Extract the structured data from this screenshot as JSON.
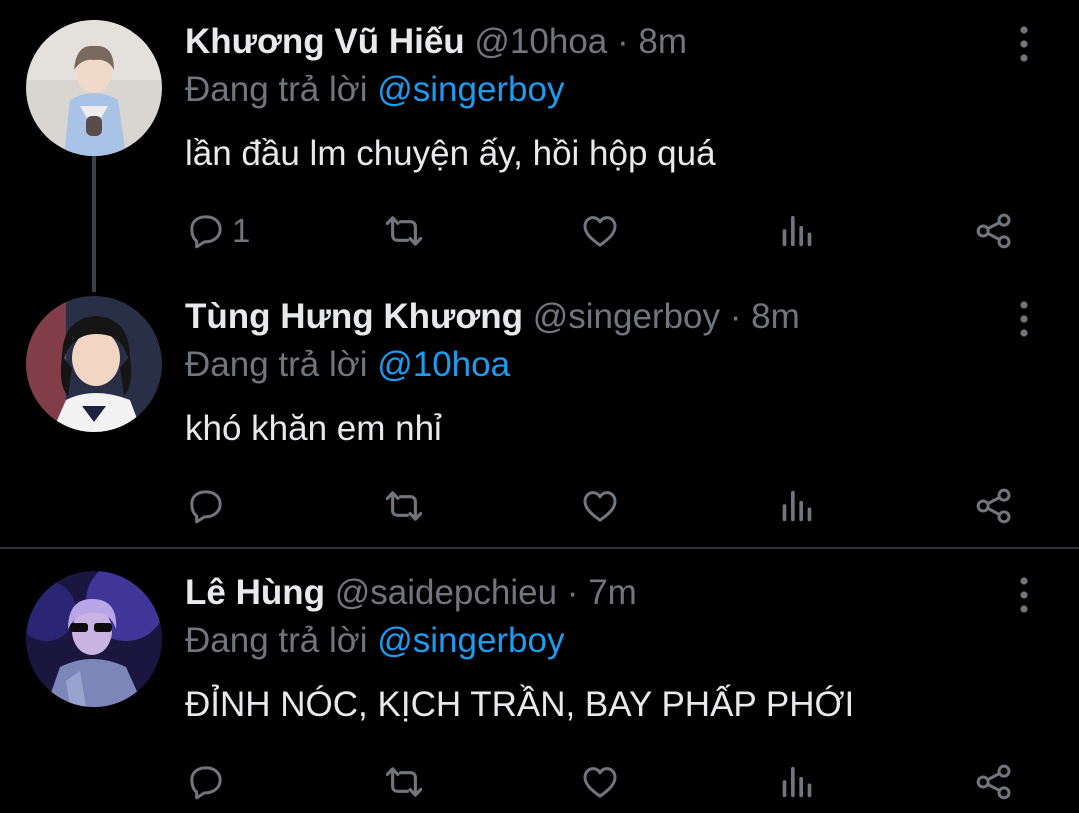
{
  "colors": {
    "background": "#000000",
    "text": "#e7e9ea",
    "muted": "#71767b",
    "mention": "#1d9bf0",
    "divider": "#2f3336"
  },
  "tweets": [
    {
      "name": "Khương Vũ Hiếu",
      "handle": "@10hoa",
      "separator": "·",
      "time": "8m",
      "reply_prefix": "Đang trả lời",
      "reply_to": "@singerboy",
      "text": "lần đầu lm chuyện ấy, hồi hộp quá",
      "reply_count": "1",
      "icons": [
        "reply-icon",
        "retweet-icon",
        "like-icon",
        "analytics-icon",
        "share-icon",
        "more-icon"
      ]
    },
    {
      "name": "Tùng Hưng Khương",
      "handle": "@singerboy",
      "separator": "·",
      "time": "8m",
      "reply_prefix": "Đang trả lời",
      "reply_to": "@10hoa",
      "text": "khó khăn em nhỉ",
      "reply_count": "",
      "icons": [
        "reply-icon",
        "retweet-icon",
        "like-icon",
        "analytics-icon",
        "share-icon",
        "more-icon"
      ]
    },
    {
      "name": "Lê Hùng",
      "handle": "@saidepchieu",
      "separator": "·",
      "time": "7m",
      "reply_prefix": "Đang trả lời",
      "reply_to": "@singerboy",
      "text": "ĐỈNH NÓC, KỊCH TRẦN, BAY PHẤP PHỚI",
      "reply_count": "",
      "icons": [
        "reply-icon",
        "retweet-icon",
        "like-icon",
        "analytics-icon",
        "share-icon",
        "more-icon"
      ]
    }
  ]
}
